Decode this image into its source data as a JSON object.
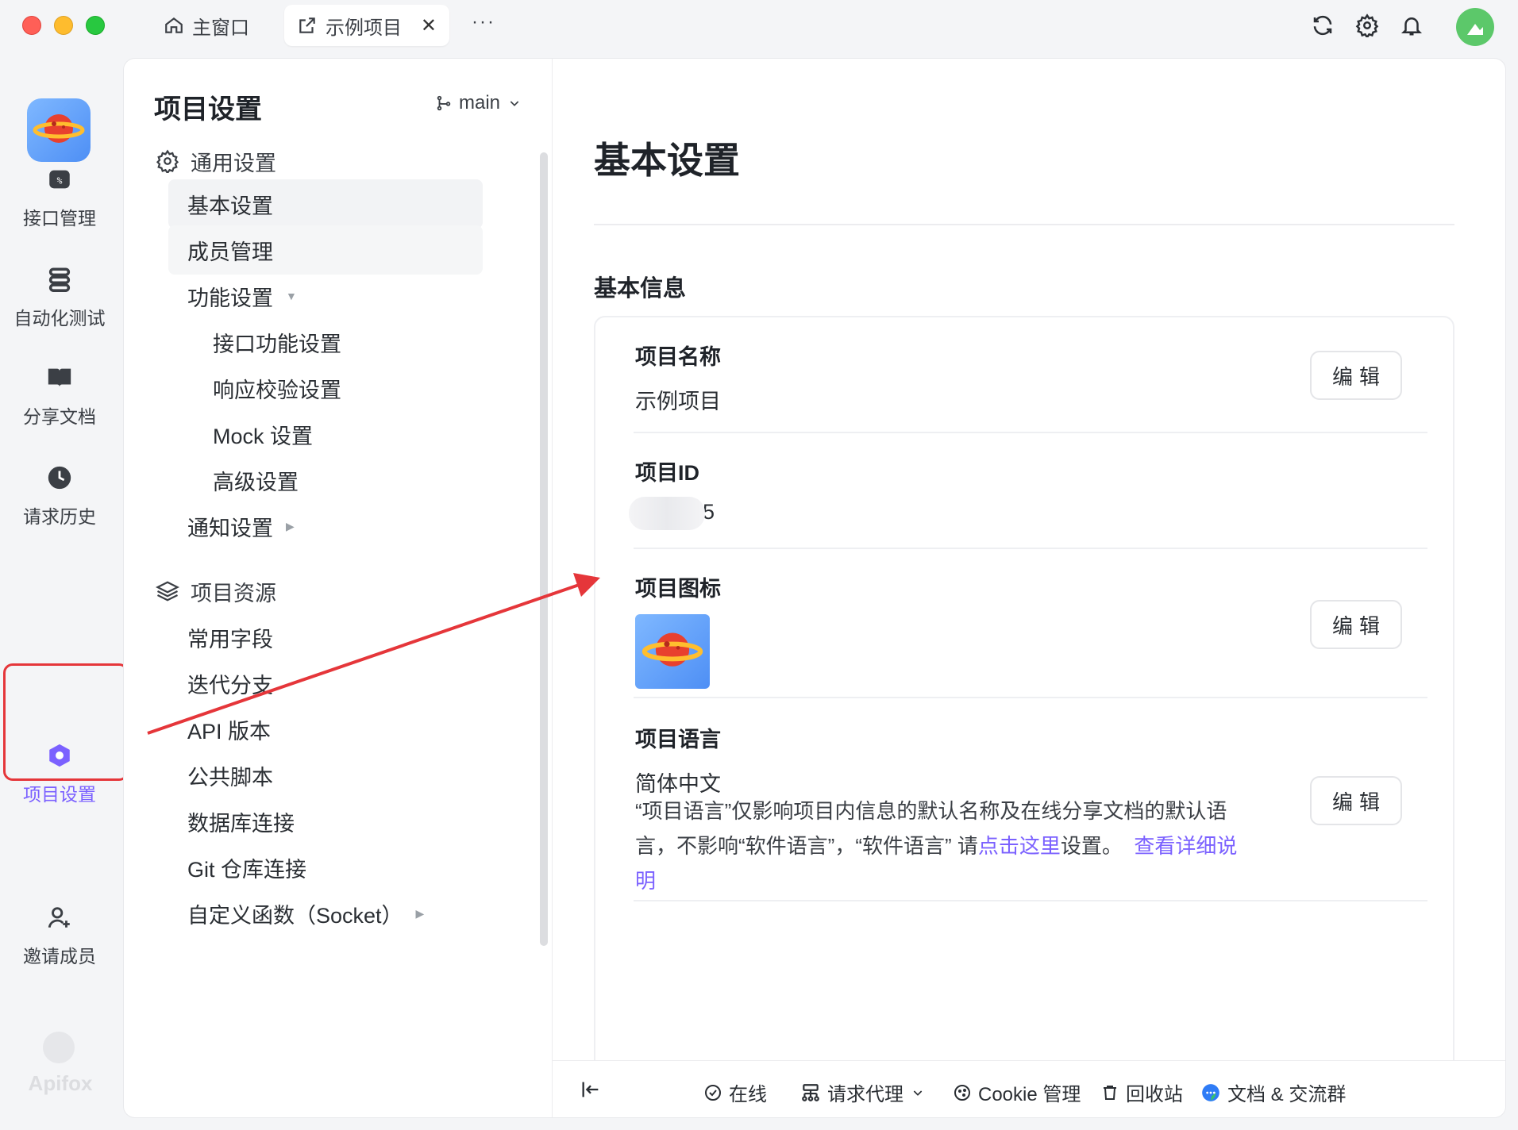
{
  "window": {
    "tabs": [
      {
        "label": "主窗口",
        "icon": "home-icon"
      },
      {
        "label": "示例项目",
        "icon": "external-link-icon",
        "close": "✕"
      }
    ],
    "more": "···"
  },
  "rail": {
    "items": [
      {
        "label": "接口管理",
        "icon": "api-icon"
      },
      {
        "label": "自动化测试",
        "icon": "automation-icon"
      },
      {
        "label": "分享文档",
        "icon": "book-icon"
      },
      {
        "label": "请求历史",
        "icon": "clock-icon"
      },
      {
        "label": "项目设置",
        "icon": "hexagon-icon"
      },
      {
        "label": "邀请成员",
        "icon": "user-add-icon"
      }
    ],
    "brand": "Apifox"
  },
  "nav": {
    "title": "项目设置",
    "branch": "main",
    "group_general": "通用设置",
    "items_general": [
      "基本设置",
      "成员管理",
      "功能设置"
    ],
    "items_feature": [
      "接口功能设置",
      "响应校验设置",
      "Mock 设置",
      "高级设置"
    ],
    "notify": "通知设置",
    "group_resources": "项目资源",
    "items_resources": [
      "常用字段",
      "迭代分支",
      "API 版本",
      "公共脚本",
      "数据库连接",
      "Git 仓库连接",
      "自定义函数（Socket）"
    ]
  },
  "content": {
    "page_title": "基本设置",
    "section_title": "基本信息",
    "edit_label": "编辑",
    "fields": {
      "name_label": "项目名称",
      "name_value": "示例项目",
      "id_label": "项目ID",
      "id_value": "55",
      "icon_label": "项目图标",
      "lang_label": "项目语言",
      "lang_value": "简体中文",
      "lang_desc_1": "“项目语言”仅影响项目内信息的默认名称及在线分享文档的默认语言，不影响“软件语言”，“软件语言” 请",
      "lang_desc_link": "点击这里",
      "lang_desc_2": "设置。",
      "lang_desc_more": "查看详细说明"
    }
  },
  "footer": {
    "online": "在线",
    "proxy": "请求代理",
    "cookie": "Cookie 管理",
    "recycle": "回收站",
    "docs": "文档 & 交流群"
  },
  "colors": {
    "accent": "#7b61ff",
    "annotation": "#e5363a"
  }
}
